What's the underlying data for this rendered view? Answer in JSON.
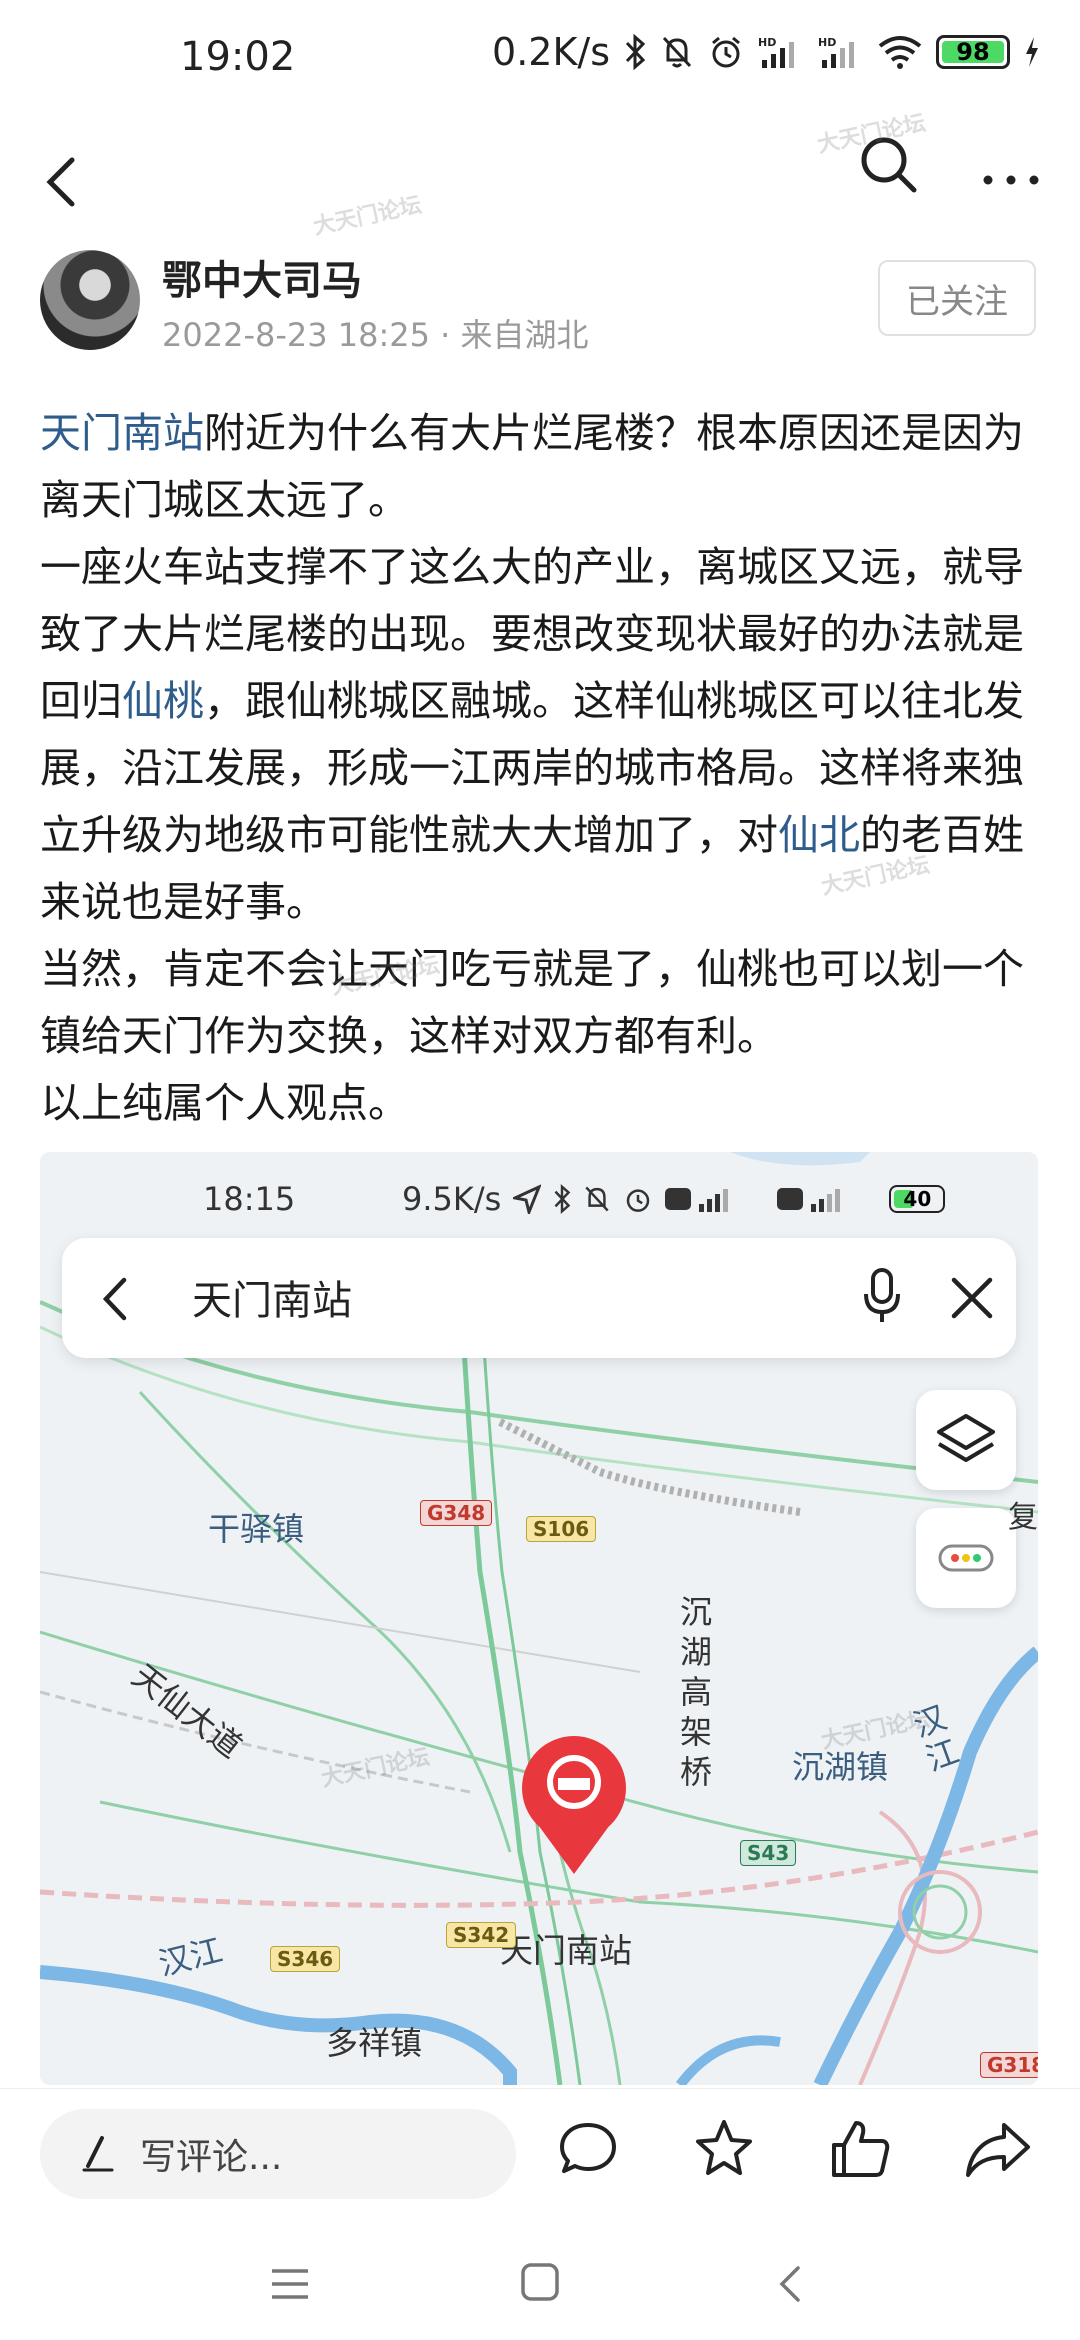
{
  "status_bar": {
    "time": "19:02",
    "net_speed": "0.2K/s",
    "battery": "98"
  },
  "author": {
    "name": "鄂中大司马",
    "date": "2022-8-23 18:25",
    "location": "来自湖北",
    "follow_label": "已关注"
  },
  "post": {
    "line1_link": "天门南站",
    "line1_rest": "附近为什么有大片烂尾楼？根本原因还是因为离天门城区太远了。",
    "p2_a": "一座火车站支撑不了这么大的产业，离城区又远，就导致了大片烂尾楼的出现。要想改变现状最好的办法就是回归",
    "p2_link1": "仙桃",
    "p2_b": "，跟仙桃城区融城。这样仙桃城区可以往北发展，沿江发展，形成一江两岸的城市格局。这样将来独立升级为地级市可能性就大大增加了，对",
    "p2_link2": "仙北",
    "p2_c": "的老百姓来说也是好事。",
    "p3": "当然，肯定不会让天门吃亏就是了，仙桃也可以划一个镇给天门作为交换，这样对双方都有利。",
    "p4": "以上纯属个人观点。"
  },
  "map_image": {
    "time": "18:15",
    "net_speed": "9.5K/s",
    "battery": "40",
    "search_query": "天门南站",
    "labels": {
      "ganyi": "干驿镇",
      "chenhu": "沉湖镇",
      "bridge": "沉湖高架桥",
      "tianxian": "天仙大道",
      "hanjiang": "汉江",
      "hanjiang2": "汉江",
      "duoxiang": "多祥镇",
      "station": "天门南站",
      "fu": "复"
    },
    "roads": {
      "g348": "G348",
      "s106": "S106",
      "s43": "S43",
      "s342": "S342",
      "s346": "S346",
      "g318": "G318"
    }
  },
  "actions": {
    "comment_placeholder": "写评论..."
  },
  "watermark": "大天门论坛"
}
